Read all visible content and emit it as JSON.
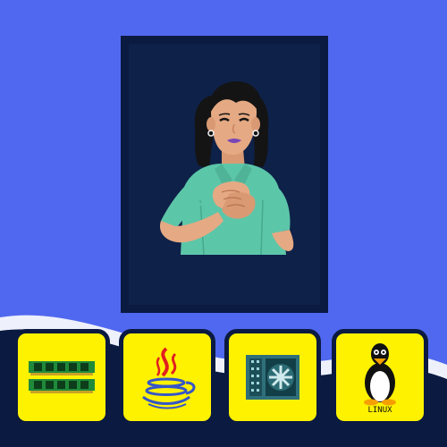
{
  "scene": {
    "background_color": "#5068ef",
    "wave_color": "#0b1a40",
    "tile_color": "#fff200"
  },
  "portrait": {
    "icon": "woman-hand-on-chest-illustration",
    "frame_color": "#0b1a40",
    "shirt_color": "#5cc6a9",
    "skin_color": "#e5a983",
    "hair_color": "#141414"
  },
  "tiles": [
    {
      "icon": "ram-memory-icon"
    },
    {
      "icon": "java-coffee-cup-icon"
    },
    {
      "icon": "cpu-chip-icon"
    },
    {
      "icon": "linux-penguin-icon",
      "caption": "LINUX"
    }
  ]
}
